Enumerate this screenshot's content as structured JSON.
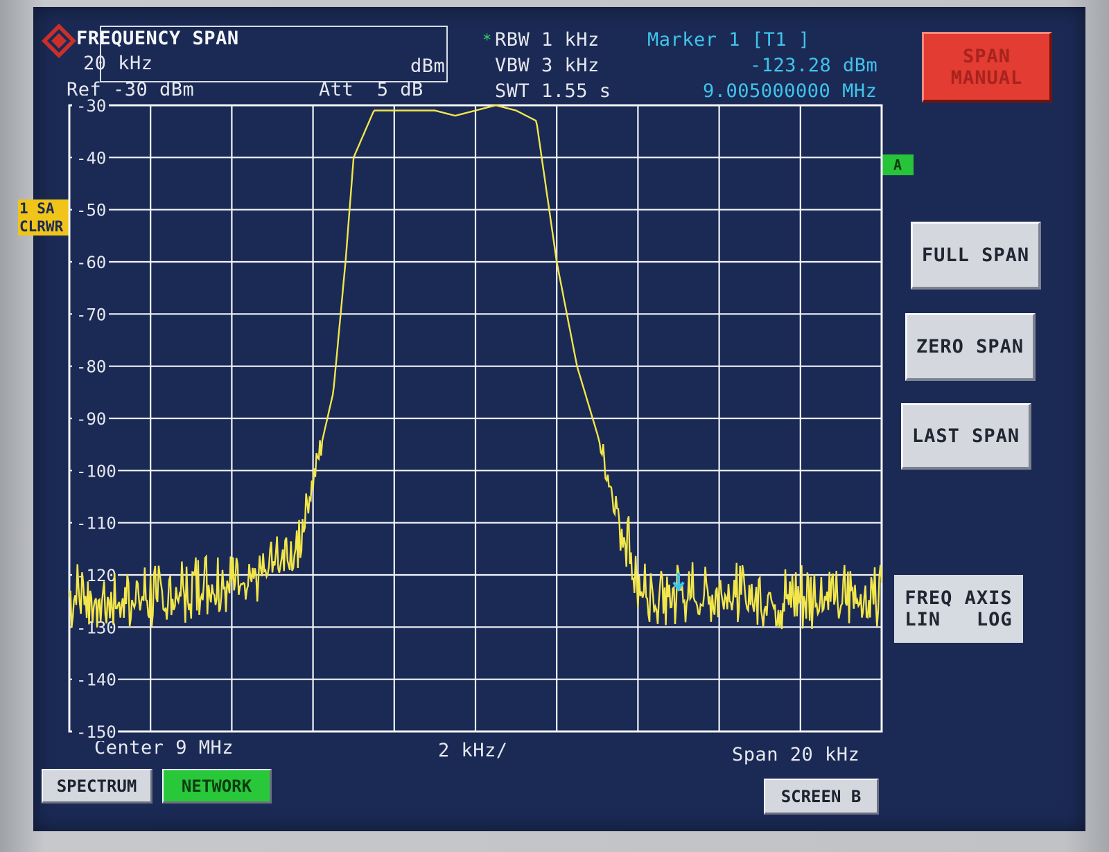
{
  "header": {
    "freq_span_title": "FREQUENCY SPAN",
    "freq_span_value": "20 kHz",
    "unit": "dBm",
    "ref": "Ref -30 dBm",
    "att": "Att  5 dB",
    "rbw_star": "*",
    "rbw": "RBW 1 kHz",
    "vbw": "VBW 3 kHz",
    "swt": "SWT 1.55 s",
    "marker_title": "Marker 1 [T1 ]",
    "marker_level": "-123.28 dBm",
    "marker_freq": "9.005000000 MHz"
  },
  "trace": {
    "tag_line1": "1 SA",
    "tag_line2": "CLRWR",
    "limit_tag": "A"
  },
  "footer": {
    "center": "Center 9 MHz",
    "per_div": "2 kHz/",
    "span": "Span 20 kHz"
  },
  "softkeys": {
    "span_manual_1": "SPAN",
    "span_manual_2": "MANUAL",
    "full_span": "FULL SPAN",
    "zero_span": "ZERO SPAN",
    "last_span": "LAST SPAN",
    "freq_axis_1": "FREQ AXIS",
    "freq_axis_2": "LIN   LOG"
  },
  "modes": {
    "spectrum": "SPECTRUM",
    "network": "NETWORK",
    "screen_b": "SCREEN B"
  },
  "colors": {
    "screen_bg": "#1b2a55",
    "trace": "#f2e64a",
    "marker": "#3fc4ec",
    "grid": "#f2f4f8"
  },
  "chart_data": {
    "type": "line",
    "ylim": [
      -150,
      -30
    ],
    "xlim": [
      8.99,
      9.01
    ],
    "x_unit": "MHz",
    "y_unit": "dBm",
    "yticks": [
      "-30",
      "-40",
      "-50",
      "-60",
      "-70",
      "-80",
      "-90",
      "-100",
      "-110",
      "-120",
      "-130",
      "-140",
      "-150"
    ],
    "grid": true,
    "series": [
      {
        "x": [
          8.99,
          8.9925,
          8.9955,
          8.996,
          8.9965,
          8.9968,
          8.997,
          8.9975,
          8.998,
          8.999,
          8.9995,
          9.0,
          9.0005,
          9.001,
          9.0015,
          9.002,
          9.0025,
          9.003,
          9.0034,
          9.0037,
          9.004,
          9.0045,
          9.005,
          9.0075,
          9.01
        ],
        "y": [
          -124,
          -124,
          -117,
          -102,
          -85,
          -60,
          -40,
          -31,
          -31,
          -31,
          -32,
          -31,
          -30,
          -31,
          -33,
          -60,
          -80,
          -93,
          -105,
          -112,
          -122,
          -124,
          -123.28,
          -124,
          -124
        ]
      }
    ],
    "marker": {
      "x": 9.005,
      "y": -123.28
    }
  }
}
